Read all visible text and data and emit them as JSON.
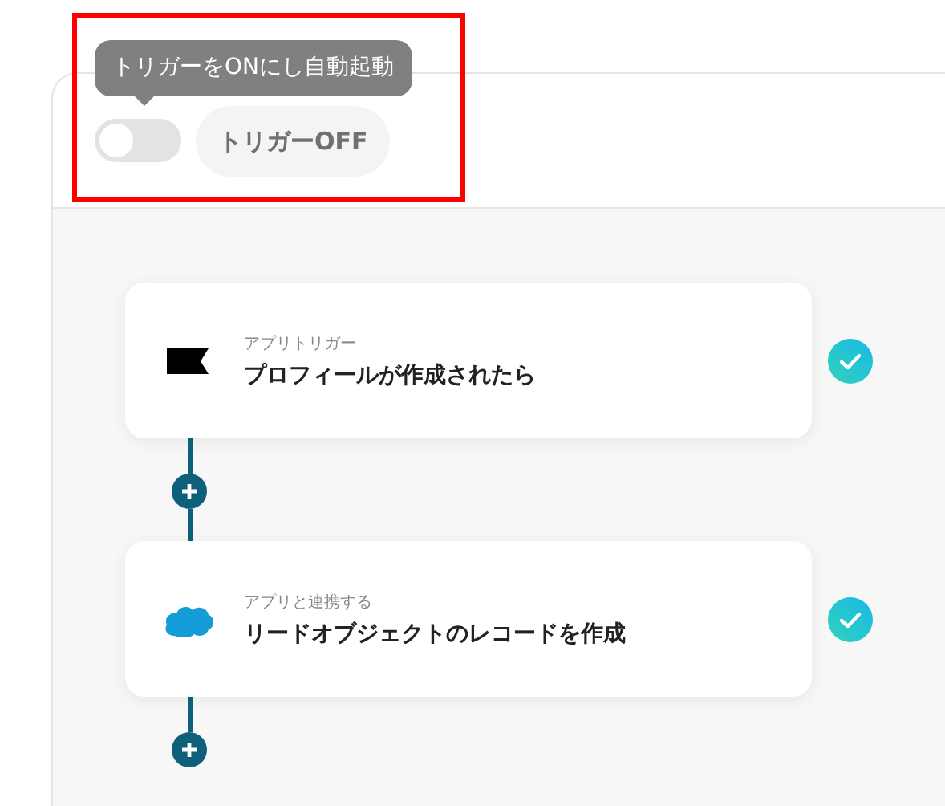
{
  "tooltip": "トリガーをONにし自動起動",
  "trigger": {
    "on": false,
    "label": "トリガーOFF"
  },
  "steps": [
    {
      "kind": "flag",
      "label": "アプリトリガー",
      "title": "プロフィールが作成されたら",
      "done": true
    },
    {
      "kind": "cloud",
      "label": "アプリと連携する",
      "title": "リードオブジェクトのレコードを作成",
      "done": true
    }
  ]
}
